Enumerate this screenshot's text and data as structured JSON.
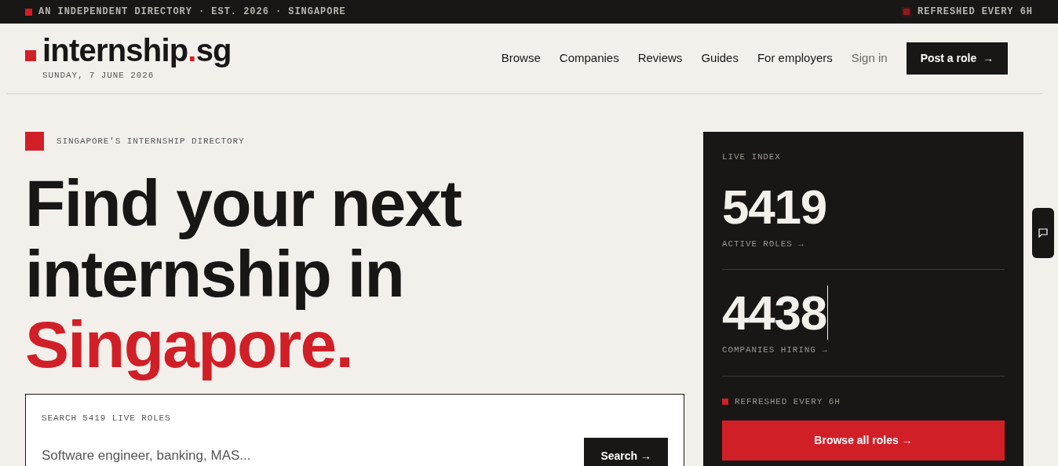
{
  "top_bar": {
    "tagline": "AN INDEPENDENT DIRECTORY · EST. 2026 · SINGAPORE",
    "refresh_note": "REFRESHED EVERY 6H"
  },
  "header": {
    "logo_name": "internship",
    "logo_dot": ".",
    "logo_tld": "sg",
    "date": "SUNDAY, 7 JUNE 2026",
    "nav": [
      {
        "label": "Browse",
        "kind": "link"
      },
      {
        "label": "Companies",
        "kind": "link"
      },
      {
        "label": "Reviews",
        "kind": "link"
      },
      {
        "label": "Guides",
        "kind": "link"
      },
      {
        "label": "For employers",
        "kind": "link"
      },
      {
        "label": "Sign in",
        "kind": "muted"
      },
      {
        "label": "Post a role  →",
        "kind": "button"
      }
    ]
  },
  "hero": {
    "eyebrow": "SINGAPORE'S INTERNSHIP DIRECTORY",
    "headline_lines": [
      "Find your next",
      "internship in"
    ],
    "headline_accent": "Singapore.",
    "search": {
      "label": "SEARCH 5419 LIVE ROLES",
      "placeholder": "Software engineer, banking, MAS...",
      "button": "Search →"
    }
  },
  "live_index": {
    "title": "LIVE INDEX",
    "stats": [
      {
        "value": "5419",
        "label": "ACTIVE ROLES →",
        "cursor": false
      },
      {
        "value": "4438",
        "label": "COMPANIES HIRING →",
        "cursor": true
      }
    ],
    "refresh_note": "REFRESHED EVERY 6H",
    "button": "Browse all roles →"
  }
}
